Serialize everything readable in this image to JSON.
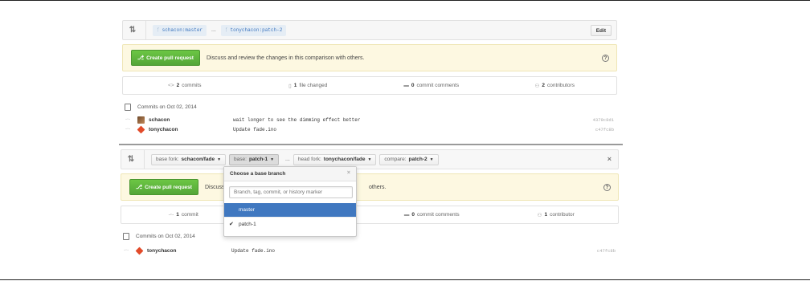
{
  "top": {
    "base_branch": "schacon:master",
    "separator": "...",
    "head_branch": "tonychacon:patch-2",
    "edit_label": "Edit",
    "create_pr_label": "Create pull request",
    "flash_text": "Discuss and review the changes in this comparison with others.",
    "stats": {
      "commits_count": "2",
      "commits_label": "commits",
      "files_count": "1",
      "files_label": "file changed",
      "comments_count": "0",
      "comments_label": "commit comments",
      "contributors_count": "2",
      "contributors_label": "contributors"
    },
    "commits_heading": "Commits on Oct 02, 2014",
    "commits": [
      {
        "author": "schacon",
        "message": "wait longer to see the dimming effect better",
        "sha": "4379c8d1"
      },
      {
        "author": "tonychacon",
        "message": "Update fade.ino",
        "sha": "c47fc8b"
      }
    ]
  },
  "bottom": {
    "base_fork_label": "base fork:",
    "base_fork_value": "schacon/fade",
    "base_label": "base:",
    "base_value": "patch-1",
    "separator": "...",
    "head_fork_label": "head fork:",
    "head_fork_value": "tonychacon/fade",
    "compare_label": "compare:",
    "compare_value": "patch-2",
    "create_pr_label": "Create pull request",
    "flash_text_start": "Discuss",
    "flash_text_end": "others.",
    "stats": {
      "commits_count": "1",
      "commits_label": "commit",
      "comments_count": "0",
      "comments_label": "commit comments",
      "contributors_count": "1",
      "contributors_label": "contributor"
    },
    "commits_heading": "Commits on Oct 02, 2014",
    "commits": [
      {
        "author": "tonychacon",
        "message": "Update fade.ino",
        "sha": "c47fc8b"
      }
    ]
  },
  "dropdown": {
    "title": "Choose a base branch",
    "filter_placeholder": "Branch, tag, commit, or history marker",
    "items": [
      {
        "label": "master",
        "highlighted": true,
        "checked": false
      },
      {
        "label": "patch-1",
        "highlighted": false,
        "checked": true
      }
    ]
  },
  "colors": {
    "create_button": "#6cc644",
    "flash_bg": "#fdf8e1",
    "highlight": "#4078c0",
    "branch_text": "#4078c0"
  },
  "icons": [
    "compare-icon",
    "branch-icon",
    "pull-request-icon",
    "help-icon",
    "commit-icon",
    "file-icon",
    "comment-icon",
    "contributors-icon",
    "calendar-icon",
    "close-icon",
    "caret-down-icon",
    "check-icon"
  ]
}
